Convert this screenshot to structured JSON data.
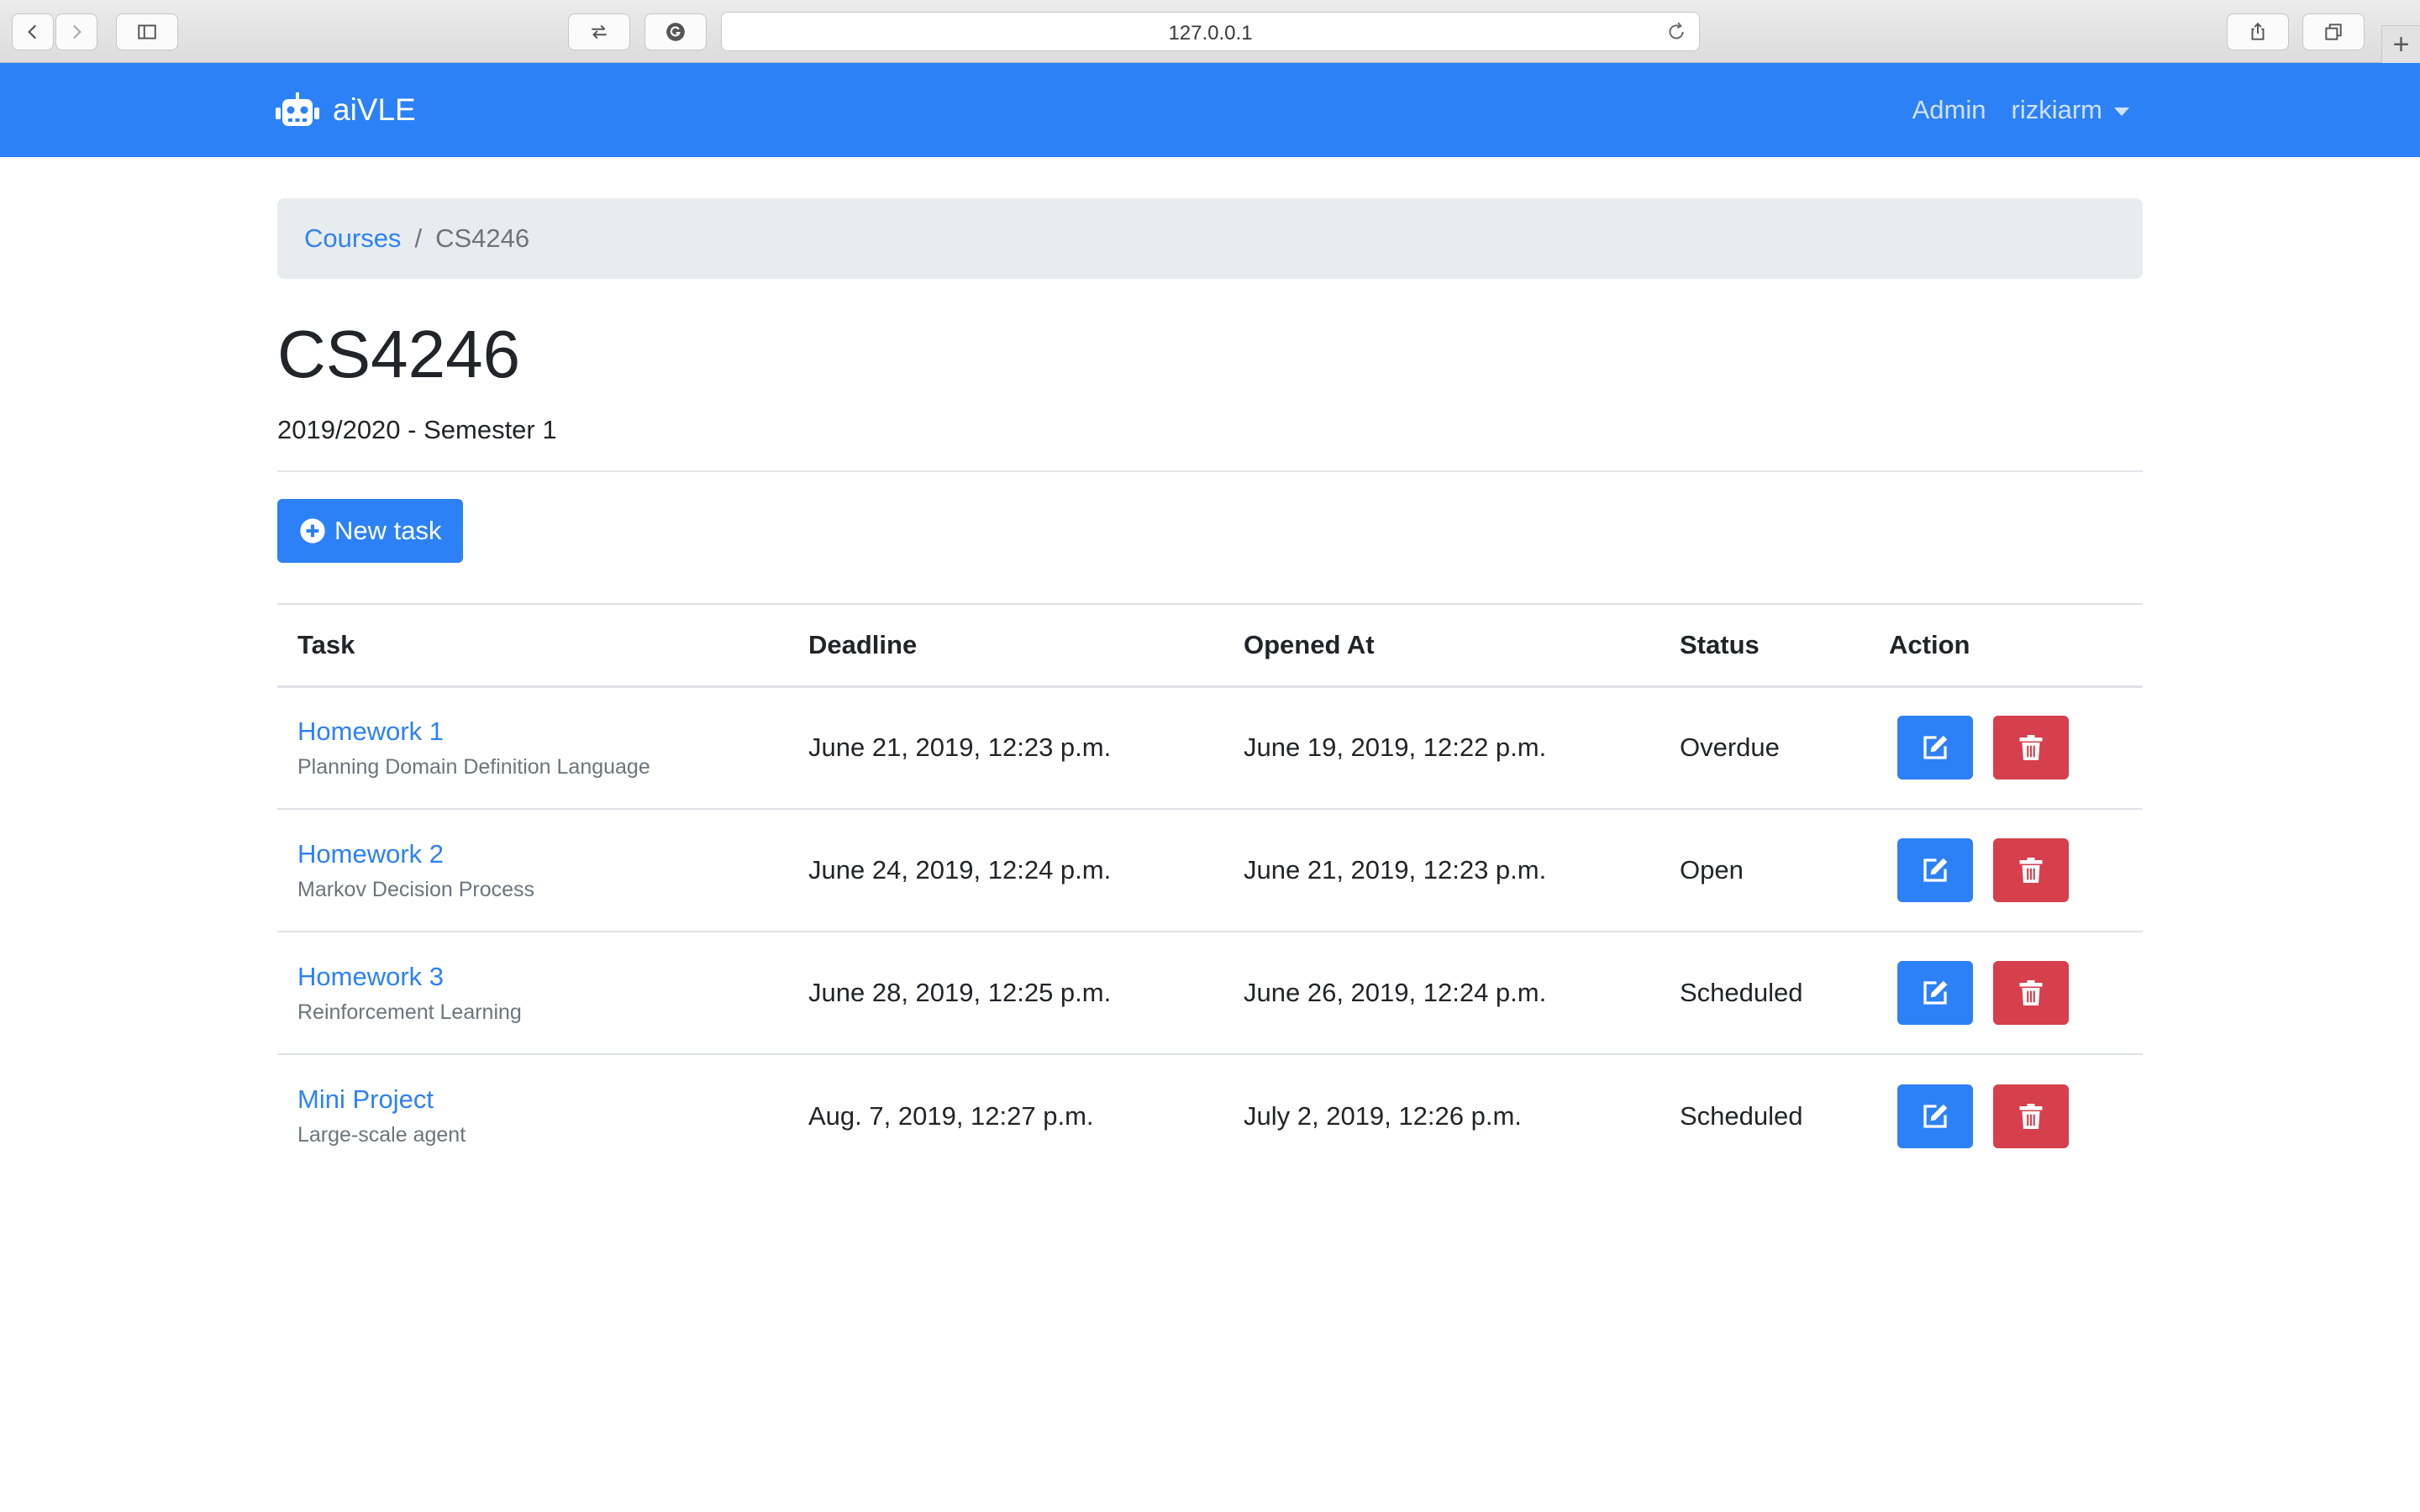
{
  "browser": {
    "url": "127.0.0.1",
    "new_tab_label": "+"
  },
  "navbar": {
    "brand": "aiVLE",
    "links": [
      {
        "label": "Admin"
      },
      {
        "label": "rizkiarm"
      }
    ]
  },
  "breadcrumb": {
    "link": "Courses",
    "separator": "/",
    "current": "CS4246"
  },
  "course": {
    "title": "CS4246",
    "subtitle": "2019/2020 - Semester 1"
  },
  "actions": {
    "new_task_label": "New task"
  },
  "table": {
    "headers": [
      "Task",
      "Deadline",
      "Opened At",
      "Status",
      "Action"
    ],
    "rows": [
      {
        "title": "Homework 1",
        "description": "Planning Domain Definition Language",
        "deadline": "June 21, 2019, 12:23 p.m.",
        "opened_at": "June 19, 2019, 12:22 p.m.",
        "status": "Overdue"
      },
      {
        "title": "Homework 2",
        "description": "Markov Decision Process",
        "deadline": "June 24, 2019, 12:24 p.m.",
        "opened_at": "June 21, 2019, 12:23 p.m.",
        "status": "Open"
      },
      {
        "title": "Homework 3",
        "description": "Reinforcement Learning",
        "deadline": "June 28, 2019, 12:25 p.m.",
        "opened_at": "June 26, 2019, 12:24 p.m.",
        "status": "Scheduled"
      },
      {
        "title": "Mini Project",
        "description": "Large-scale agent",
        "deadline": "Aug. 7, 2019, 12:27 p.m.",
        "opened_at": "July 2, 2019, 12:26 p.m.",
        "status": "Scheduled"
      }
    ]
  },
  "colors": {
    "primary": "#2d81f6",
    "danger": "#d63f4c",
    "breadcrumb_bg": "#e9ecef",
    "muted": "#6c757d"
  },
  "icons": {
    "brand": "robot-icon",
    "new_task": "plus-circle-icon",
    "edit": "edit-icon",
    "delete": "trash-icon"
  }
}
